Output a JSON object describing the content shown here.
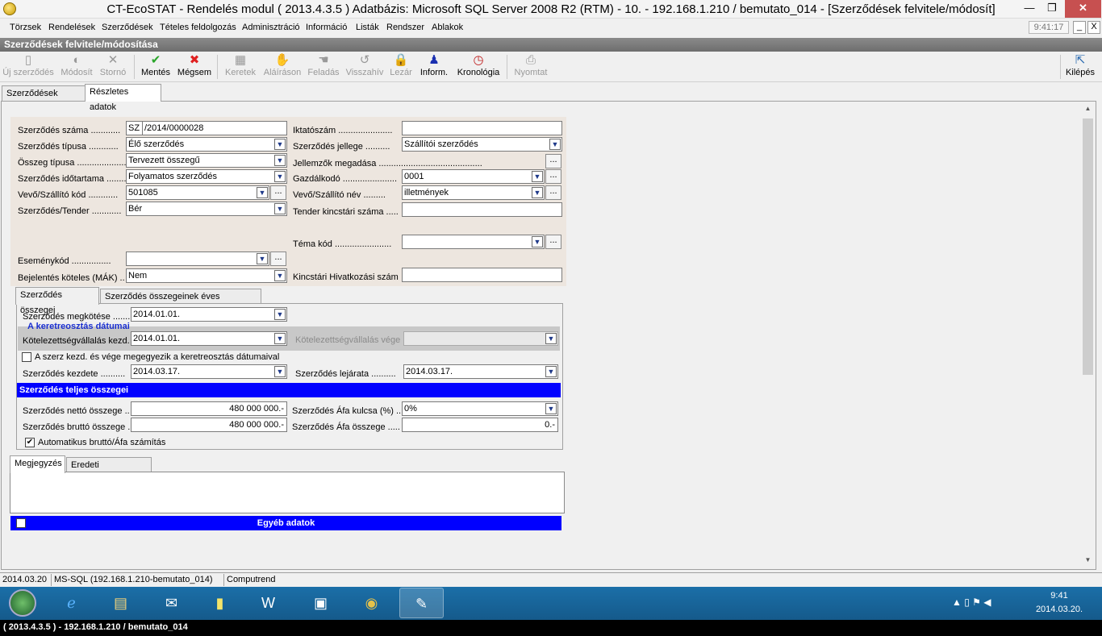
{
  "window": {
    "title": "CT-EcoSTAT - Rendelés modul ( 2013.4.3.5 ) Adatbázis: Microsoft SQL Server 2008 R2 (RTM) - 10. - 192.168.1.210 / bemutato_014 - [Szerződések felvitele/módosít]",
    "min": "—",
    "max": "❐",
    "close": "✕"
  },
  "menu": {
    "items": [
      "Törzsek",
      "Rendelések",
      "Szerződések",
      "Tételes feldolgozás",
      "Adminisztráció",
      "Információ",
      "Listák",
      "Rendszer",
      "Ablakok"
    ],
    "clock": "9:41:17",
    "mdi_min": "_",
    "mdi_max": "□",
    "mdi_close": "X"
  },
  "form_title": "Szerződések felvitele/módosítása",
  "toolbar": {
    "uj": "Új szerződés",
    "modosit": "Módosít",
    "storno": "Stornó",
    "mentes": "Mentés",
    "megsem": "Mégsem",
    "keretek": "Keretek",
    "alairason": "Aláíráson",
    "feladas": "Feladás",
    "visszahiv": "Visszahív",
    "lezar": "Lezár",
    "inform": "Inform.",
    "kronologia": "Kronológia",
    "nyomtat": "Nyomtat",
    "kilepes": "Kilépés"
  },
  "tabs_main": [
    "Szerződések listája",
    "Részletes adatok"
  ],
  "fields": {
    "szam_label": "Szerződés száma",
    "szam_prefix": "SZ",
    "szam_value": "/2014/0000028",
    "tipusa_label": "Szerződés típusa",
    "tipusa_value": "Élő szerződés",
    "osszeg_tipusa_label": "Összeg típusa",
    "osszeg_tipusa_value": "Tervezett összegű",
    "idotartama_label": "Szerződés időtartama",
    "idotartama_value": "Folyamatos szerződés",
    "vevo_kod_label": "Vevő/Szállító kód",
    "vevo_kod_value": "501085",
    "tender_label": "Szerződés/Tender",
    "tender_value": "Bér",
    "iktatoszam_label": "Iktatószám",
    "iktatoszam_value": "",
    "jellege_label": "Szerződés jellege",
    "jellege_value": "Szállítói szerződés",
    "jellemzok_label": "Jellemzők megadása",
    "gazdalkodo_label": "Gazdálkodó",
    "gazdalkodo_value": "0001",
    "vevo_nev_label": "Vevő/Szállító név",
    "vevo_nev_value": "illetmények",
    "tender_kincstari_label": "Tender kincstári száma",
    "tender_kincstari_value": "",
    "tema_kod_label": "Téma kód",
    "tema_kod_value": "",
    "esemenykod_label": "Eseménykód",
    "esemenykod_value": "",
    "bejelentes_label": "Bejelentés köteles (MÁK)",
    "bejelentes_value": "Nem",
    "kincstari_hiv_label": "Kincstári Hivatkozási szám",
    "kincstari_hiv_value": ""
  },
  "tabs_sub": [
    "Szerződés összegei",
    "Szerződés összegeinek éves felosztása"
  ],
  "sums": {
    "megkotese_label": "Szerződés megkötése",
    "megkotese_value": "2014.01.01.",
    "keret_title": "A keretreosztás dátumai",
    "kotel_kezd_label": "Kötelezettségvállalás kezd.",
    "kotel_kezd_value": "2014.01.01.",
    "kotel_vege_label": "Kötelezettségvállalás vége",
    "kotel_vege_value": "",
    "egyezik_label": "A szerz kezd. és vége megegyezik a keretreosztás dátumaival",
    "egyezik_checked": false,
    "kezdete_label": "Szerződés kezdete",
    "kezdete_value": "2014.03.17.",
    "lejarata_label": "Szerződés lejárata",
    "lejarata_value": "2014.03.17.",
    "teljes_title": "Szerződés teljes összegei",
    "netto_label": "Szerződés nettó összege",
    "netto_value": "480 000 000.-",
    "afa_kulcs_label": "Szerződés Áfa kulcsa (%)",
    "afa_kulcs_value": "0%",
    "brutto_label": "Szerződés bruttó összege",
    "brutto_value": "480 000 000.-",
    "afa_osszeg_label": "Szerződés Áfa összege",
    "afa_osszeg_value": "0.-",
    "auto_label": "Automatikus bruttó/Áfa számítás",
    "auto_checked": true,
    "check_mark": "✔"
  },
  "tabs_note": [
    "Megjegyzés",
    "Eredeti megjegyzés"
  ],
  "egyeb_title": "Egyéb adatok",
  "status": {
    "date": "2014.03.20",
    "db": "MS-SQL (192.168.1.210-bemutato_014)",
    "company": "Computrend"
  },
  "taskbar": {
    "time": "9:41",
    "date": "2014.03.20.",
    "tray": "▲ ▯ ⚑ ◀"
  },
  "bottom": "( 2013.4.3.5 ) - 192.168.1.210 / bemutato_014",
  "ellipsis": "...",
  "arrow": "▼"
}
